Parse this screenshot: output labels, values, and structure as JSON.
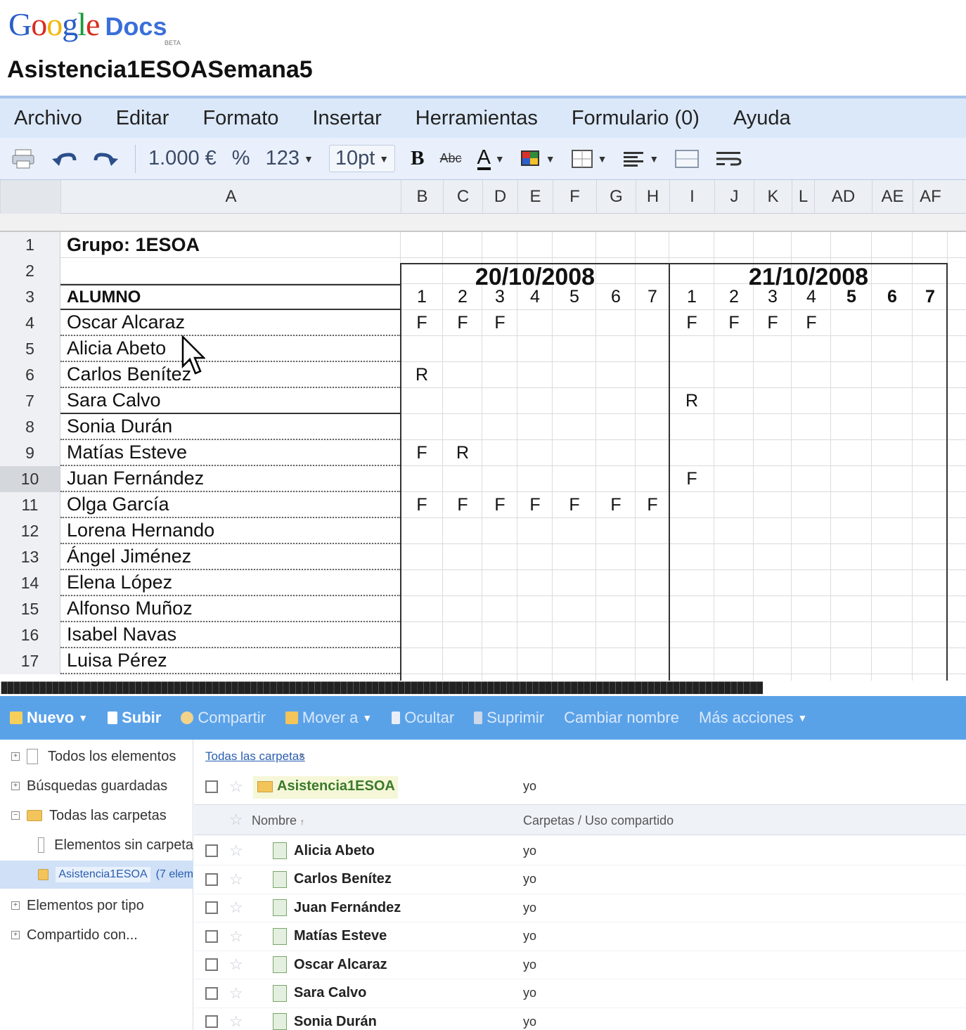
{
  "app": {
    "logo_google": "Google",
    "logo_docs": "Docs",
    "logo_beta": "BETA",
    "doc_title": "Asistencia1ESOASemana5"
  },
  "menu": [
    "Archivo",
    "Editar",
    "Formato",
    "Insertar",
    "Herramientas",
    "Formulario (0)",
    "Ayuda"
  ],
  "toolbar": {
    "print_icon": "printer-icon",
    "undo_icon": "undo-icon",
    "redo_icon": "redo-icon",
    "currency": "1.000 €",
    "percent": "%",
    "number_format": "123",
    "font_size": "10pt",
    "bold": "B",
    "strike": "Abc",
    "text_color": "A"
  },
  "columns": [
    "A",
    "B",
    "C",
    "D",
    "E",
    "F",
    "G",
    "H",
    "I",
    "J",
    "K",
    "L",
    "AD",
    "AE",
    "AF"
  ],
  "sheet": {
    "group_label": "Grupo: 1ESOA",
    "date1": "20/10/2008",
    "date2": "21/10/2008",
    "student_header": "ALUMNO",
    "periods": [
      "1",
      "2",
      "3",
      "4",
      "5",
      "6",
      "7"
    ],
    "row_numbers": [
      "1",
      "2",
      "3",
      "4",
      "5",
      "6",
      "7",
      "8",
      "9",
      "10",
      "11",
      "12",
      "13",
      "14",
      "15",
      "16",
      "17"
    ],
    "students": [
      {
        "name": "Oscar Alcaraz",
        "d1": [
          "F",
          "F",
          "F",
          "",
          "",
          "",
          ""
        ],
        "d2": [
          "F",
          "F",
          "F",
          "F",
          "",
          "",
          ""
        ]
      },
      {
        "name": "Alicia Abeto",
        "d1": [
          "",
          "",
          "",
          "",
          "",
          "",
          ""
        ],
        "d2": [
          "",
          "",
          "",
          "",
          "",
          "",
          ""
        ]
      },
      {
        "name": "Carlos Benítez",
        "d1": [
          "R",
          "",
          "",
          "",
          "",
          "",
          ""
        ],
        "d2": [
          "",
          "",
          "",
          "",
          "",
          "",
          ""
        ]
      },
      {
        "name": "Sara Calvo",
        "d1": [
          "",
          "",
          "",
          "",
          "",
          "",
          ""
        ],
        "d2": [
          "R",
          "",
          "",
          "",
          "",
          "",
          ""
        ]
      },
      {
        "name": "Sonia Durán",
        "d1": [
          "",
          "",
          "",
          "",
          "",
          "",
          ""
        ],
        "d2": [
          "",
          "",
          "",
          "",
          "",
          "",
          ""
        ]
      },
      {
        "name": "Matías Esteve",
        "d1": [
          "F",
          "R",
          "",
          "",
          "",
          "",
          ""
        ],
        "d2": [
          "",
          "",
          "",
          "",
          "",
          "",
          ""
        ]
      },
      {
        "name": "Juan Fernández",
        "d1": [
          "",
          "",
          "",
          "",
          "",
          "",
          ""
        ],
        "d2": [
          "F",
          "",
          "",
          "",
          "",
          "",
          ""
        ]
      },
      {
        "name": "Olga García",
        "d1": [
          "F",
          "F",
          "F",
          "F",
          "F",
          "F",
          "F"
        ],
        "d2": [
          "",
          "",
          "",
          "",
          "",
          "",
          ""
        ]
      },
      {
        "name": "Lorena Hernando",
        "d1": [
          "",
          "",
          "",
          "",
          "",
          "",
          ""
        ],
        "d2": [
          "",
          "",
          "",
          "",
          "",
          "",
          ""
        ]
      },
      {
        "name": "Ángel Jiménez",
        "d1": [
          "",
          "",
          "",
          "",
          "",
          "",
          ""
        ],
        "d2": [
          "",
          "",
          "",
          "",
          "",
          "",
          ""
        ]
      },
      {
        "name": "Elena López",
        "d1": [
          "",
          "",
          "",
          "",
          "",
          "",
          ""
        ],
        "d2": [
          "",
          "",
          "",
          "",
          "",
          "",
          ""
        ]
      },
      {
        "name": "Alfonso Muñoz",
        "d1": [
          "",
          "",
          "",
          "",
          "",
          "",
          ""
        ],
        "d2": [
          "",
          "",
          "",
          "",
          "",
          "",
          ""
        ]
      },
      {
        "name": "Isabel Navas",
        "d1": [
          "",
          "",
          "",
          "",
          "",
          "",
          ""
        ],
        "d2": [
          "",
          "",
          "",
          "",
          "",
          "",
          ""
        ]
      },
      {
        "name": "Luisa Pérez",
        "d1": [
          "",
          "",
          "",
          "",
          "",
          "",
          ""
        ],
        "d2": [
          "",
          "",
          "",
          "",
          "",
          "",
          ""
        ]
      }
    ]
  },
  "docs_list": {
    "toolbar": [
      "Nuevo",
      "Subir",
      "Compartir",
      "Mover a",
      "Ocultar",
      "Suprimir",
      "Cambiar nombre",
      "Más acciones"
    ],
    "sidebar": [
      "Todos los elementos",
      "Búsquedas guardadas",
      "Todas las carpetas",
      "Elementos sin carpeta",
      "Asistencia1ESOA",
      "(7 elem",
      "Elementos por tipo",
      "Compartido con..."
    ],
    "breadcrumb": "Todas las carpetas",
    "folder_name": "Asistencia1ESOA",
    "folder_owner": "yo",
    "col_name": "Nombre",
    "col_folders": "Carpetas / Uso compartido",
    "files": [
      {
        "name": "Alicia Abeto",
        "owner": "yo"
      },
      {
        "name": "Carlos Benítez",
        "owner": "yo"
      },
      {
        "name": "Juan Fernández",
        "owner": "yo"
      },
      {
        "name": "Matías Esteve",
        "owner": "yo"
      },
      {
        "name": "Oscar Alcaraz",
        "owner": "yo"
      },
      {
        "name": "Sara Calvo",
        "owner": "yo"
      },
      {
        "name": "Sonia Durán",
        "owner": "yo"
      }
    ]
  }
}
